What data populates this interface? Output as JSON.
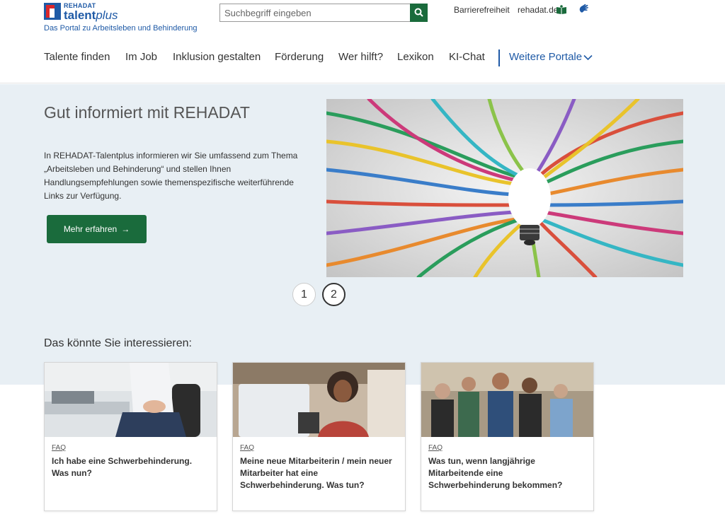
{
  "header": {
    "logo_brand": "REHADAT",
    "logo_name_bold": "talent",
    "logo_name_italic": "plus",
    "tagline": "Das Portal zu Arbeitsleben und Behinderung",
    "search_placeholder": "Suchbegriff eingeben",
    "toplinks": [
      "Barrierefreiheit",
      "rehadat.de"
    ],
    "nav": [
      "Talente finden",
      "Im Job",
      "Inklusion gestalten",
      "Förderung",
      "Wer hilft?",
      "Lexikon",
      "KI-Chat"
    ],
    "nav_more": "Weitere Portale"
  },
  "hero": {
    "title": "Gut informiert mit REHADAT",
    "text": "In REHADAT-Talentplus informieren wir Sie umfassend zum Thema „Arbeitsleben und Behinderung“ und stellen Ihnen Handlungsempfehlungen sowie themenspezifische weiterführende Links zur Verfügung.",
    "button_label": "Mehr erfahren",
    "pager": [
      "1",
      "2"
    ]
  },
  "section": {
    "title": "Das könnte Sie interessieren:"
  },
  "cards": [
    {
      "tag": "FAQ",
      "title": "Ich habe eine Schwerbehinderung. Was nun?"
    },
    {
      "tag": "FAQ",
      "title": "Meine neue Mitarbeiterin / mein neuer Mitarbeiter hat eine Schwerbehinderung. Was tun?"
    },
    {
      "tag": "FAQ",
      "title": "Was tun, wenn langjährige Mitarbeitende eine Schwerbehinderung bekommen?"
    }
  ],
  "colors": {
    "brand_blue": "#1f5aa6",
    "button_green": "#1a6b3c",
    "hero_bg": "#e8eff4"
  },
  "icons": [
    "search-icon",
    "arrow-right-icon",
    "chevron-down-icon",
    "easy-read-book-icon",
    "sign-language-icon"
  ]
}
